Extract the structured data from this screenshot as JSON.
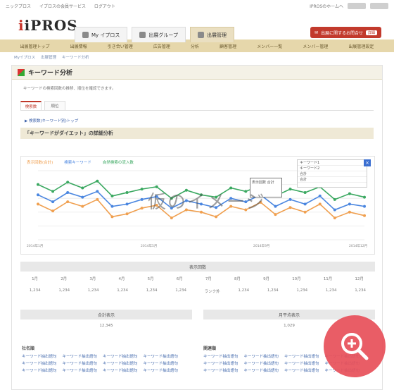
{
  "top": {
    "left": [
      "ニックプロス",
      "イプロスの会員サービス",
      "ログアウト"
    ],
    "right": "IPROSのホームへ"
  },
  "brand": {
    "logo": "iPROS",
    "tabs": [
      "My イプロス",
      "出展グループ",
      "出展管理"
    ],
    "cta": "出展に関するお問合せ",
    "cta_badge": "詳細"
  },
  "nav": [
    "出展管理トップ",
    "出展情報",
    "引き合い管理",
    "広告管理",
    "分析",
    "顧客管理",
    "メンバー一覧",
    "メンバー管理",
    "出展管理設定"
  ],
  "crumb": [
    "Myイプロス",
    "出展管理",
    "キーワード分析"
  ],
  "panel": {
    "title": "キーワード分析",
    "desc": "キーワードの検索回数の推移、順位を確認できます。",
    "tabs": [
      "検索数",
      "順位"
    ],
    "link": "▶ 検索数(キーワード別)トップ",
    "section": "「キーワードがダイエット」の詳細分析"
  },
  "legend": [
    "表示回数(合計)",
    "検索キーワード",
    "自然検索の流入数"
  ],
  "tip": [
    "キーワード1",
    "キーワード2",
    "合計",
    "合計"
  ],
  "watermark": "仮のイメージ",
  "callout": "表示回数 合計",
  "xlabels": [
    "2014年1月",
    "2014年5月",
    "2014年9月",
    "2014年12月"
  ],
  "table": {
    "head": "表示回数",
    "months": [
      "1月",
      "2月",
      "3月",
      "4月",
      "5月",
      "6月",
      "7月",
      "8月",
      "9月",
      "10月",
      "11月",
      "12月"
    ],
    "values": [
      "1,234",
      "1,234",
      "1,234",
      "1,234",
      "1,234",
      "1,234",
      "ランク外",
      "1,234",
      "1,234",
      "1,234",
      "1,234",
      "1,234"
    ]
  },
  "boxes": [
    {
      "head": "合計表示",
      "value": "12,345"
    },
    {
      "head": "月平均表示",
      "value": "1,029"
    }
  ],
  "sections": {
    "left": "社名順",
    "right": "関連順"
  },
  "keywords": [
    "キーワード抽出語句",
    "キーワード抽出語句",
    "キーワード抽出語句",
    "キーワード抽出語句"
  ],
  "chart_data": {
    "type": "line",
    "series": [
      {
        "name": "表示回数(合計)",
        "values": [
          62,
          50,
          66,
          58,
          70,
          40,
          45,
          55,
          60,
          38,
          52,
          48,
          40,
          58,
          52,
          65,
          44,
          56,
          48,
          62,
          38,
          48,
          42
        ]
      },
      {
        "name": "検索キーワード",
        "values": [
          78,
          66,
          82,
          74,
          84,
          58,
          62,
          70,
          75,
          55,
          68,
          62,
          56,
          72,
          66,
          78,
          58,
          70,
          62,
          76,
          52,
          62,
          58
        ]
      },
      {
        "name": "自然検索の流入数",
        "values": [
          96,
          84,
          100,
          90,
          102,
          76,
          82,
          88,
          92,
          72,
          86,
          78,
          74,
          90,
          84,
          94,
          76,
          88,
          82,
          92,
          70,
          80,
          74
        ]
      }
    ],
    "colors": [
      "#f0a050",
      "#4a86e0",
      "#3aa860"
    ]
  }
}
